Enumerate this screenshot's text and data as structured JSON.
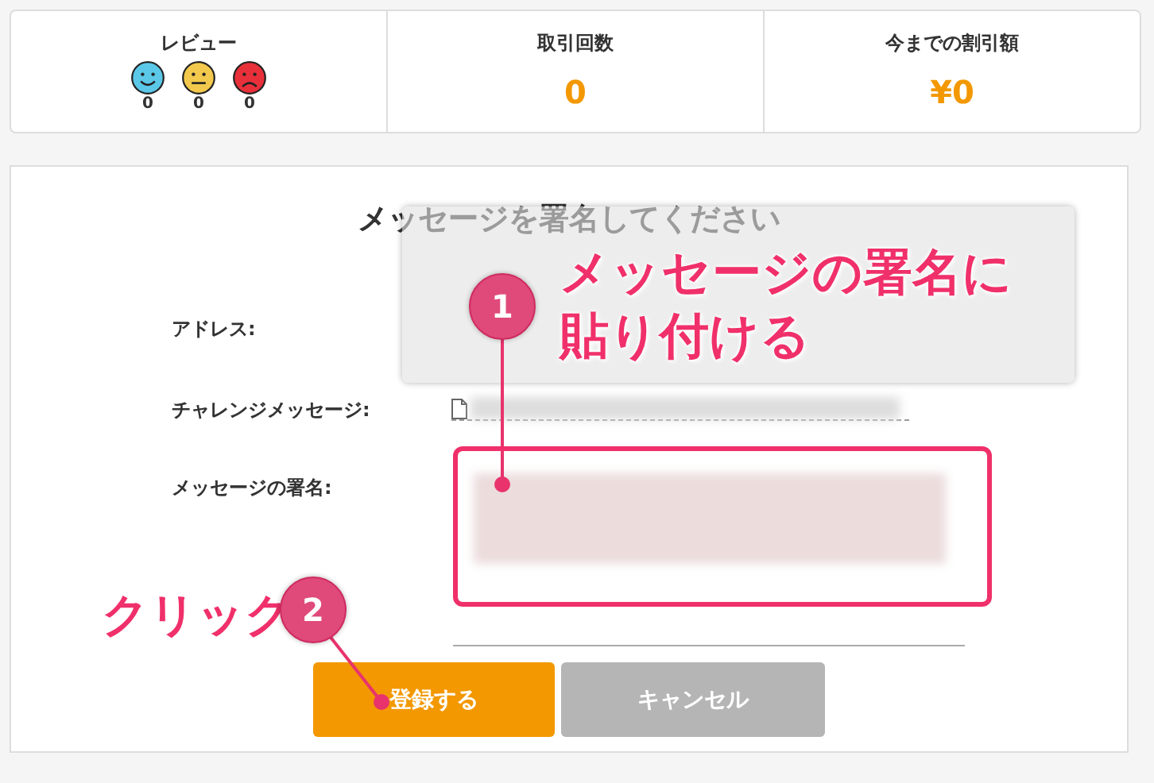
{
  "stats": {
    "review": {
      "label": "レビュー",
      "faces": [
        {
          "kind": "happy",
          "count": "0"
        },
        {
          "kind": "neutral",
          "count": "0"
        },
        {
          "kind": "sad",
          "count": "0"
        }
      ]
    },
    "items": [
      {
        "label": "取引回数",
        "value": "0"
      },
      {
        "label": "今までの割引額",
        "value": "¥0"
      }
    ]
  },
  "form": {
    "title": "メッセージを署名してください",
    "fields": [
      {
        "label": "アドレス:",
        "kind": "hidden"
      },
      {
        "label": "チャレンジメッセージ:",
        "kind": "copy"
      },
      {
        "label": "メッセージの署名:",
        "kind": "textarea"
      }
    ],
    "buttons": [
      {
        "label": "登録する",
        "kind": "primary"
      },
      {
        "label": "キャンセル",
        "kind": "secondary"
      }
    ]
  },
  "annotations": [
    {
      "number": "1",
      "text": "メッセージの署名に貼り付ける"
    },
    {
      "number": "2",
      "text": "クリック"
    }
  ]
}
